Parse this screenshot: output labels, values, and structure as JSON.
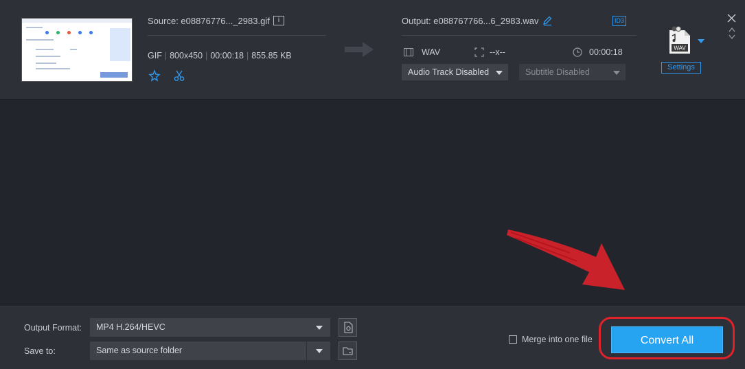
{
  "file": {
    "source_name": "Source: e08876776..._2983.gif",
    "format": "GIF",
    "resolution": "800x450",
    "duration": "00:00:18",
    "size": "855.85 KB",
    "icons": {
      "info": "info-icon",
      "effect": "star-effect-icon",
      "cut": "scissors-icon"
    }
  },
  "output": {
    "name": "Output: e088767766...6_2983.wav",
    "badge": "ID3",
    "format": "WAV",
    "resolution": "--x--",
    "duration": "00:00:18",
    "audio_track": "Audio Track Disabled",
    "subtitle": "Subtitle Disabled",
    "format_icon_label": "WAV",
    "settings_label": "Settings"
  },
  "bottom": {
    "output_format_label": "Output Format:",
    "output_format_value": "MP4 H.264/HEVC",
    "save_to_label": "Save to:",
    "save_to_value": "Same as source folder",
    "merge_label": "Merge into one file",
    "convert_label": "Convert All"
  },
  "colors": {
    "accent": "#26a4f2",
    "highlight_ring": "#e0222b",
    "background": "#23252d",
    "panel": "#2e3038"
  }
}
